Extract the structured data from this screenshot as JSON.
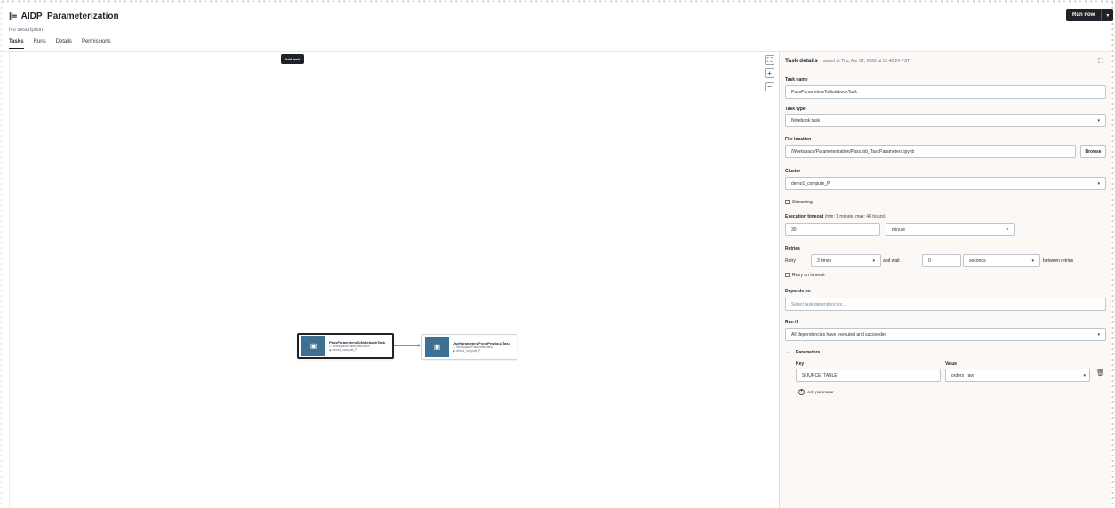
{
  "job": {
    "icon": "job-icon",
    "title": "AIDP_Parameterization",
    "description": "No description"
  },
  "header": {
    "run_now_label": "Run now",
    "run_menu_caret": "▾"
  },
  "tabs": [
    {
      "label": "Tasks",
      "active": true
    },
    {
      "label": "Runs",
      "active": false
    },
    {
      "label": "Details",
      "active": false
    },
    {
      "label": "Permissions",
      "active": false
    }
  ],
  "canvas": {
    "add_task_label": "Add task",
    "zoom_fit": "⛶",
    "zoom_in": "+",
    "zoom_out": "−",
    "nodes": [
      {
        "title": "PassParametersToNotebookTask",
        "path": "/Workspace/Parameterization",
        "cluster": "demo1_compute_P",
        "selected": true
      },
      {
        "title": "UseParametersFromPreviousTask",
        "path": "/Workspace/Parameterization",
        "cluster": "demo1_compute_P",
        "selected": false
      }
    ]
  },
  "panel": {
    "title": "Task details",
    "saved_text": "saved at Thu, Apr 02, 2026 at 12:42:24 PST",
    "task_name_label": "Task name",
    "task_name_value": "PassParametersToNotebookTask",
    "task_type_label": "Task type",
    "task_type_value": "Notebook task",
    "file_location_label": "File location",
    "file_location_value": "/Workspace/Parameterization/PassJob_TaskParameters.ipynb",
    "browse_label": "Browse",
    "cluster_label": "Cluster",
    "cluster_value": "demo1_compute_P",
    "streaming_label": "Streaming",
    "streaming_checked": false,
    "timeout_label": "Execution timeout",
    "timeout_hint": "(min: 1 minute, max: 48 hours)",
    "timeout_value": "30",
    "timeout_unit": "minute",
    "retries_label": "Retries",
    "retry_prefix": "Retry",
    "retry_count": "3 times",
    "retry_and_wait": "and wait",
    "retry_wait_value": "0",
    "retry_wait_unit": "seconds",
    "retry_between": "between retries",
    "retry_on_timeout_label": "Retry on timeout",
    "retry_on_timeout_checked": false,
    "depends_on_label": "Depends on",
    "depends_on_placeholder": "Select task dependencies...",
    "run_if_label": "Run if",
    "run_if_value": "All dependencies have executed and succeeded",
    "parameters_label": "Parameters",
    "key_header": "Key",
    "value_header": "Value",
    "params": [
      {
        "key": "SOURCE_TABLE",
        "value": "orders_raw"
      }
    ],
    "add_parameter_label": "Add parameter"
  }
}
